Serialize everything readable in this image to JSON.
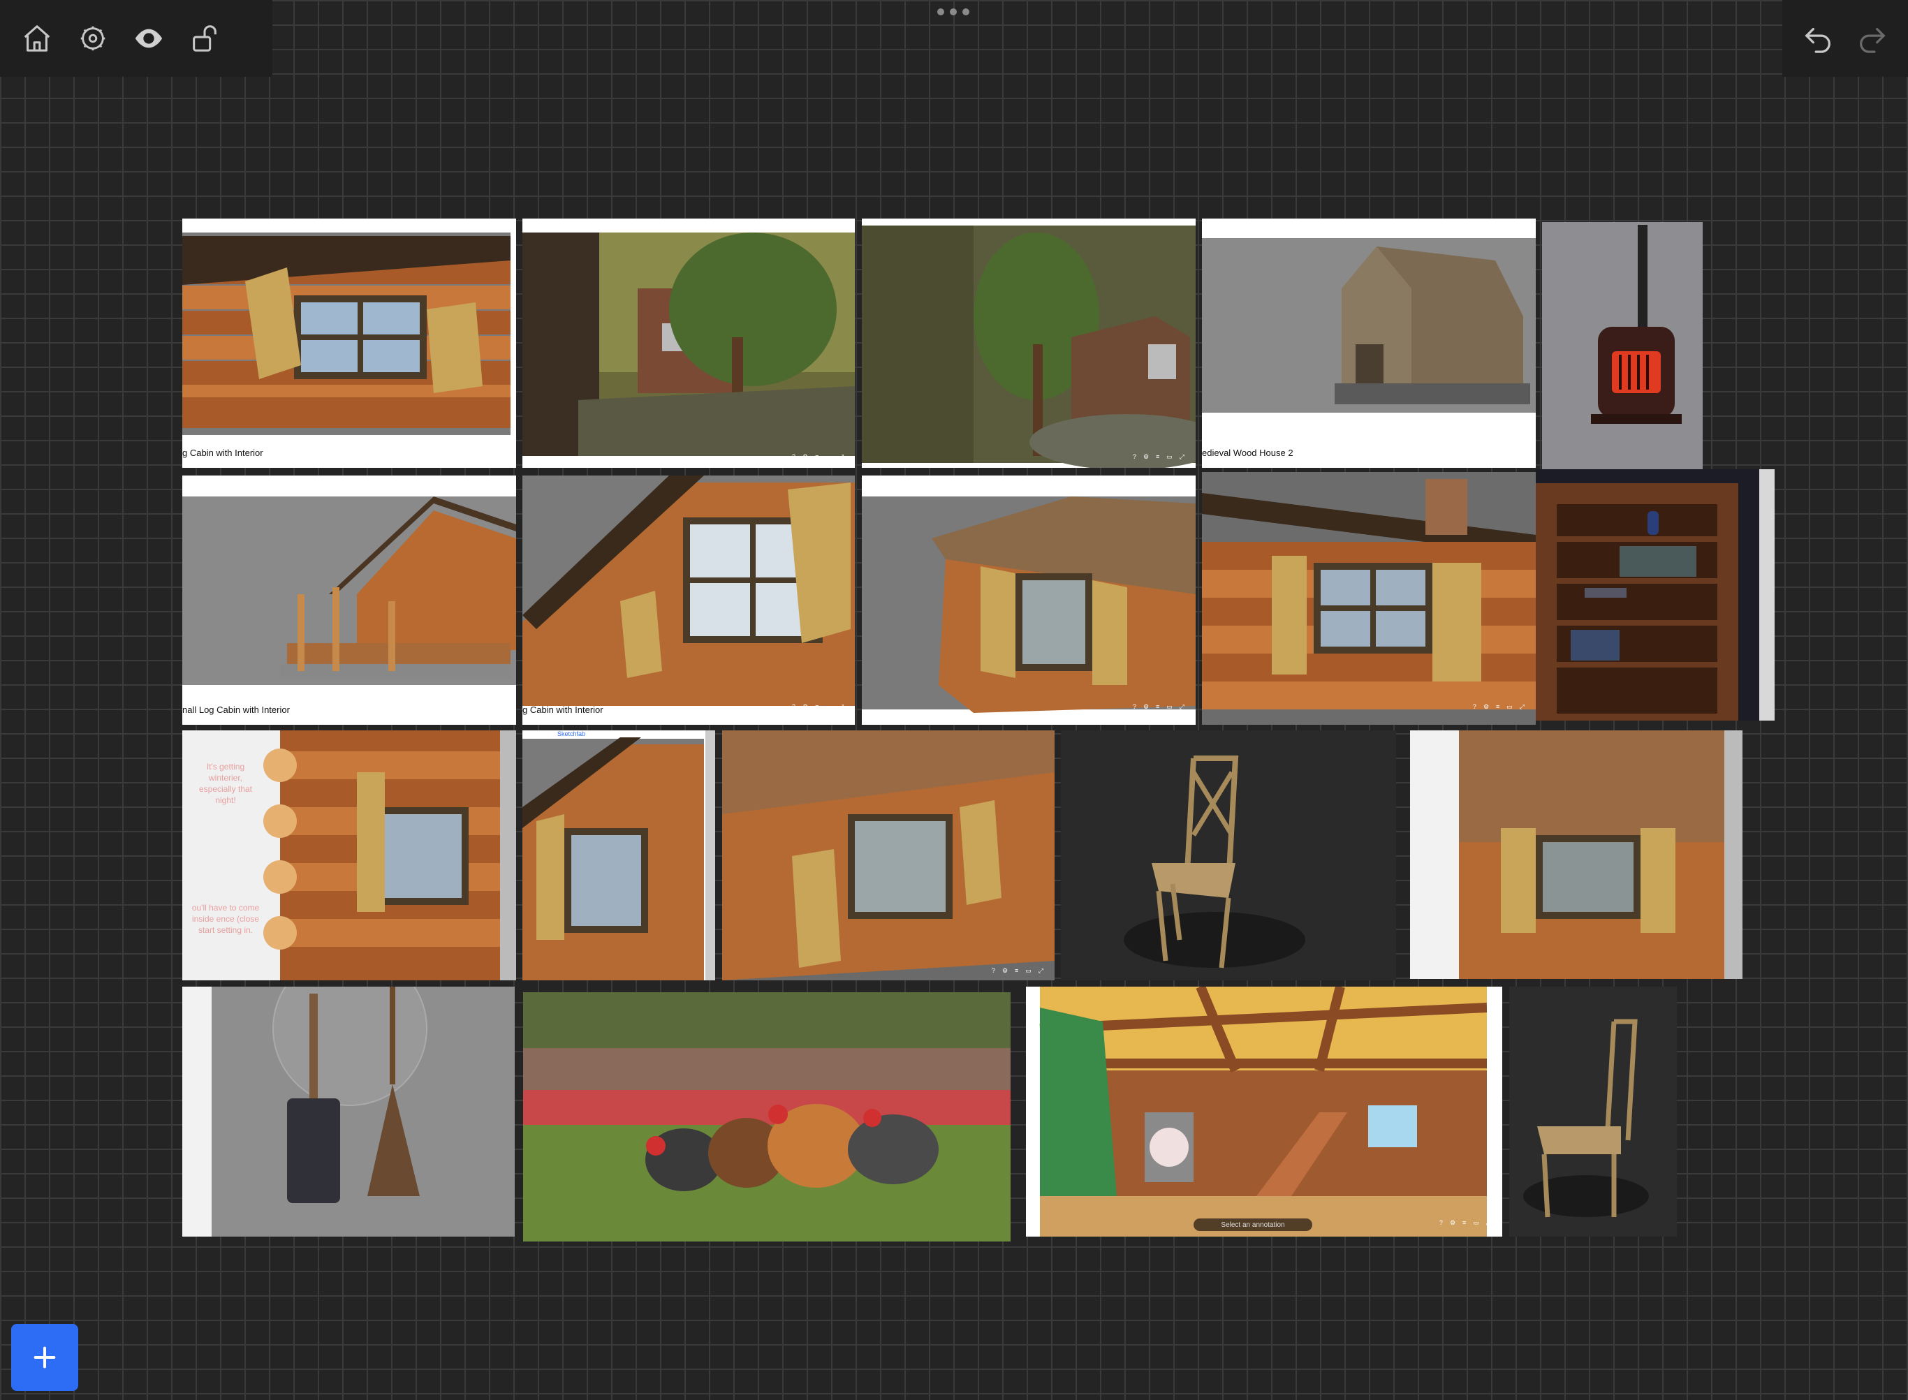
{
  "toolbar": {
    "left_icons": [
      "home-icon",
      "settings-icon",
      "eye-icon",
      "unlock-icon"
    ],
    "right_icons": [
      "undo-icon",
      "redo-icon"
    ],
    "more_icon": "more-dots-icon"
  },
  "cards": {
    "c1": {
      "title": "g Cabin with Interior"
    },
    "c4": {
      "title": "edieval Wood House 2"
    },
    "c6": {
      "title": "nall Log Cabin with Interior"
    },
    "c7": {
      "title": "g Cabin with Interior"
    },
    "c11": {
      "note_top": "It's getting winterier, especially that night!",
      "note_bottom": "ou'll have to come inside ence (close start setting in."
    },
    "c12": {
      "header": "Sketchfab"
    },
    "c19": {
      "annotation": "Select an annotation"
    }
  },
  "viewer_icons": [
    "?",
    "⚙",
    "≡",
    "▭",
    "⤢"
  ],
  "add_button": {
    "icon": "plus-icon",
    "label": "+"
  },
  "colors": {
    "accent": "#2d6cf5",
    "background": "#242424"
  }
}
